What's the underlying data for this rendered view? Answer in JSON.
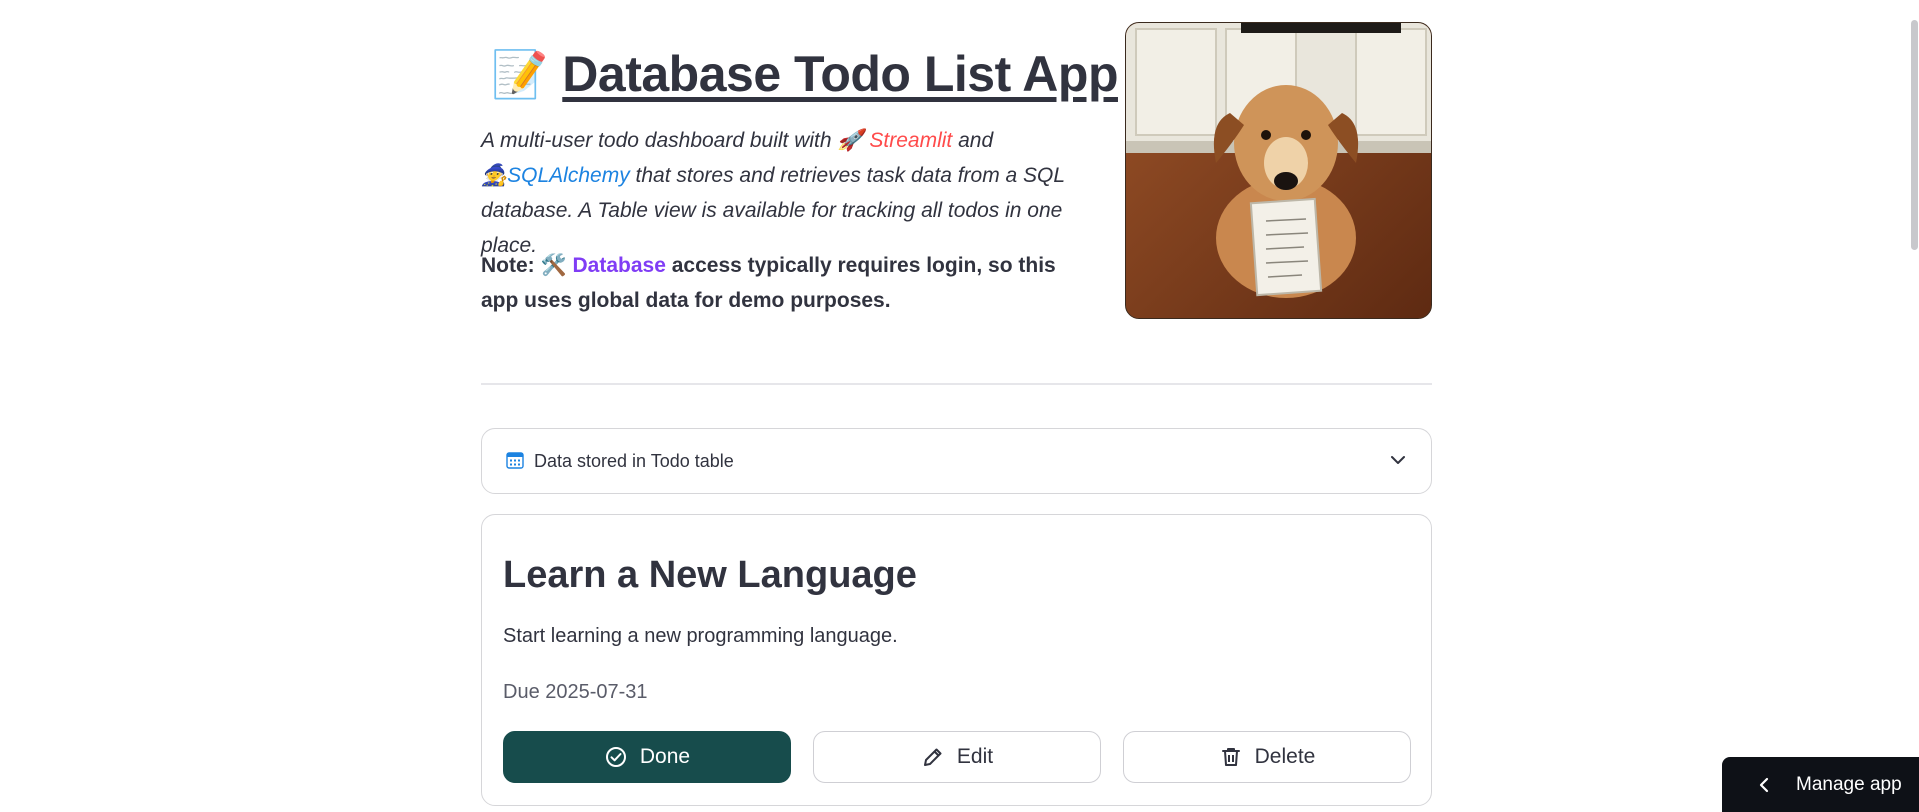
{
  "header": {
    "title_emoji": "📝",
    "title": "Database Todo List App",
    "description": {
      "part1": "A multi-user todo dashboard built with ",
      "streamlit_emoji": "🚀",
      "streamlit_link": "Streamlit",
      "part2": " and",
      "sqlalchemy_emoji": "🧙",
      "sqlalchemy_link": "SQLAlchemy",
      "part3": " that stores and retrieves task data from a SQL database. A Table view is available for tracking all todos in one place."
    },
    "note": {
      "prefix": "Note: ",
      "emoji": "🛠️",
      "database_link": "Database",
      "suffix": " access typically requires login, so this app uses global data for demo purposes."
    }
  },
  "expander": {
    "label": "Data stored in Todo table",
    "icon": "calendar-icon",
    "toggle_icon": "chevron-down-icon"
  },
  "todo": {
    "title": "Learn a New Language",
    "description": "Start learning a new programming language.",
    "due": "Due 2025-07-31",
    "buttons": {
      "done": "Done",
      "edit": "Edit",
      "delete": "Delete"
    }
  },
  "manage_app": {
    "label": "Manage app"
  },
  "colors": {
    "text": "#31333f",
    "streamlit_red": "#ff4b4b",
    "link_blue": "#1c83e1",
    "link_purple": "#803df5",
    "done_button": "#174c4c",
    "manage_bg": "#0e1117"
  }
}
